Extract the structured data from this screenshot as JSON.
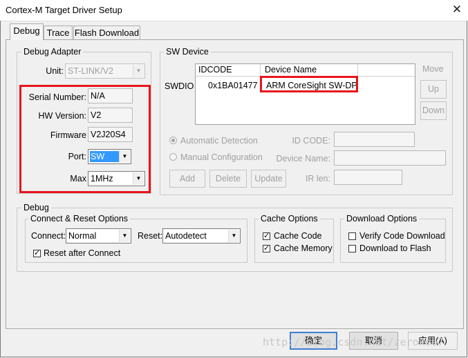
{
  "window": {
    "title": "Cortex-M Target Driver Setup",
    "close_glyph": "✕"
  },
  "tabs": [
    {
      "label": "Debug",
      "active": true
    },
    {
      "label": "Trace",
      "active": false
    },
    {
      "label": "Flash Download",
      "active": false
    }
  ],
  "debug_adapter": {
    "title": "Debug Adapter",
    "unit_label": "Unit:",
    "unit_value": "ST-LINK/V2",
    "serial_label": "Serial Number:",
    "serial_value": "N/A",
    "hw_label": "HW Version:",
    "hw_value": "V2",
    "fw_label": "Firmware",
    "fw_value": "V2J20S4",
    "port_label": "Port:",
    "port_value": "SW",
    "max_label": "Max",
    "max_value": "1MHz"
  },
  "sw_device": {
    "title": "SW Device",
    "swdio_label": "SWDIO",
    "columns": [
      "IDCODE",
      "Device Name"
    ],
    "rows": [
      {
        "idcode": "0x1BA01477",
        "device_name": "ARM CoreSight SW-DP"
      }
    ],
    "move_label": "Move",
    "up_label": "Up",
    "down_label": "Down",
    "automatic_detection": "Automatic Detection",
    "manual_configuration": "Manual Configuration",
    "id_code_label": "ID CODE:",
    "device_name_label": "Device Name:",
    "ir_len_label": "IR len:",
    "add_label": "Add",
    "delete_label": "Delete",
    "update_label": "Update"
  },
  "debug": {
    "title": "Debug",
    "connect_reset": {
      "title": "Connect & Reset Options",
      "connect_label": "Connect:",
      "connect_value": "Normal",
      "reset_label": "Reset:",
      "reset_value": "Autodetect",
      "reset_after_connect": "Reset after Connect",
      "reset_after_connect_checked": true
    },
    "cache": {
      "title": "Cache Options",
      "cache_code": "Cache Code",
      "cache_code_checked": true,
      "cache_memory": "Cache Memory",
      "cache_memory_checked": true
    },
    "download": {
      "title": "Download Options",
      "verify": "Verify Code Download",
      "verify_checked": false,
      "to_flash": "Download to Flash",
      "to_flash_checked": false
    }
  },
  "footer": {
    "ok": "确定",
    "cancel": "取消",
    "apply": "应用(A)"
  },
  "watermark": "http://blog.csdn.net/zerokee7",
  "icons": {
    "dropdown": "chevron-down-icon",
    "check": "check-icon",
    "close": "close-icon"
  },
  "colors": {
    "highlight_red": "#e8141c",
    "selection_blue": "#3399ff",
    "default_button_border": "#3c7fd4"
  }
}
